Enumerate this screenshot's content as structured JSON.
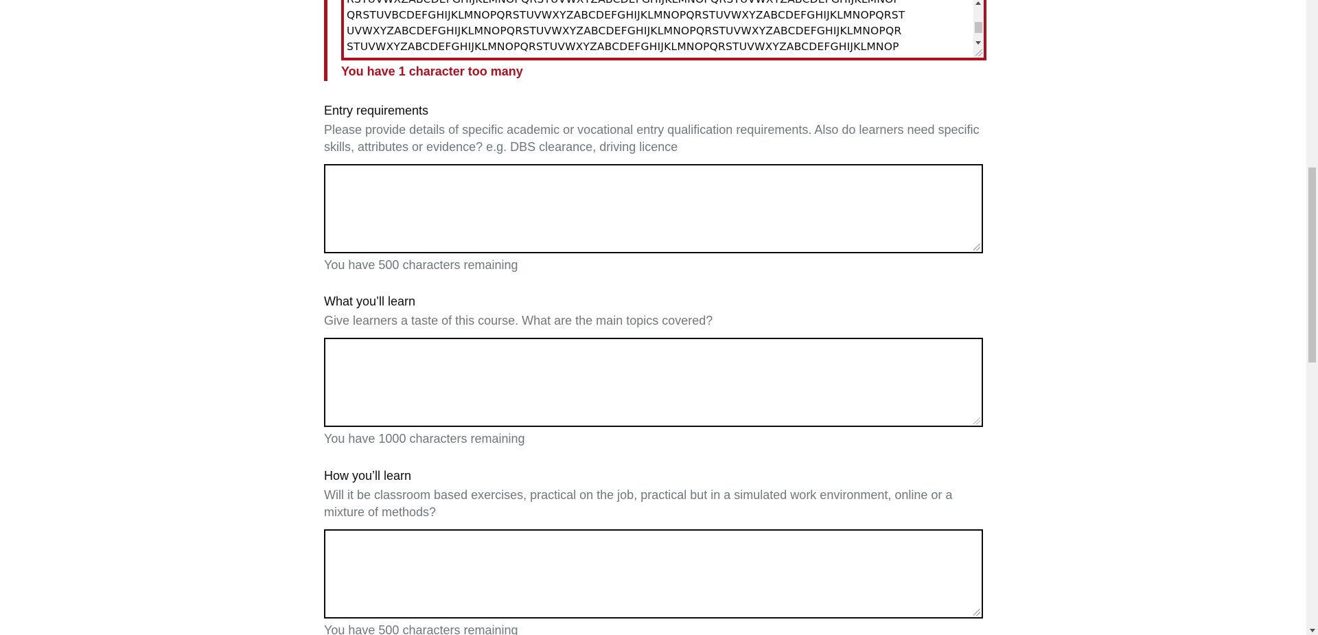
{
  "error_field": {
    "lines": [
      "RSTUVWXZABCDEFGHIJKLMNOPQRSTUVWXYZABCDEFGHIJKLMNOPQRSTUVWXYZABCDEFGHIJKLMNOP",
      "QRSTUVBCDEFGHIJKLMNOPQRSTUVWXYZABCDEFGHIJKLMNOPQRSTUVWXYZABCDEFGHIJKLMNOPQRST",
      "UVWXYZABCDEFGHIJKLMNOPQRSTUVWXYZABCDEFGHIJKLMNOPQRSTUVWXYZABCDEFGHIJKLMNOPQR",
      "STUVWXYZABCDEFGHIJKLMNOPQRSTUVWXYZABCDEFGHIJKLMNOPQRSTUVWXYZABCDEFGHIJKLMNOP"
    ],
    "error_message": "You have 1 character too many"
  },
  "entry_requirements": {
    "label": "Entry requirements",
    "hint": "Please provide details of specific academic or vocational entry qualification requirements. Also do learners need specific skills, attributes or evidence? e.g. DBS clearance, driving licence",
    "value": "",
    "count": "You have 500 characters remaining"
  },
  "what_youll_learn": {
    "label": "What you’ll learn",
    "hint": "Give learners a taste of this course. What are the main topics covered?",
    "value": "",
    "count": "You have 1000 characters remaining"
  },
  "how_youll_learn": {
    "label": "How you’ll learn",
    "hint": "Will it be classroom based exercises, practical on the job, practical but in a simulated work environment, online or a mixture of methods?",
    "value": "",
    "count": "You have 500 characters remaining"
  },
  "colors": {
    "error": "#b10e1e",
    "text": "#0b0c0c",
    "hint": "#6f777b"
  }
}
